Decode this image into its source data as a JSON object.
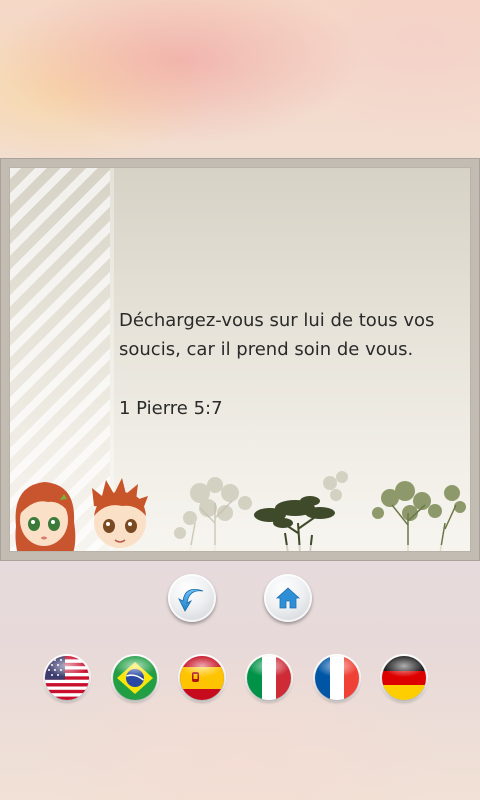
{
  "quote": {
    "text": "Déchargez-vous sur lui de tous vos soucis, car il prend soin de vous.",
    "reference": "1 Pierre 5:7"
  },
  "nav": {
    "back_icon": "back-arrow-icon",
    "home_icon": "home-icon"
  },
  "languages": [
    {
      "code": "en",
      "icon": "usa-flag-icon"
    },
    {
      "code": "pt-BR",
      "icon": "brazil-flag-icon"
    },
    {
      "code": "es",
      "icon": "spain-flag-icon"
    },
    {
      "code": "it",
      "icon": "italy-flag-icon"
    },
    {
      "code": "fr",
      "icon": "france-flag-icon"
    },
    {
      "code": "de",
      "icon": "germany-flag-icon"
    }
  ],
  "colors": {
    "card_frame": "#c2bcb3",
    "text": "#2a2a2a",
    "accent_blue": "#2f8fd6"
  }
}
